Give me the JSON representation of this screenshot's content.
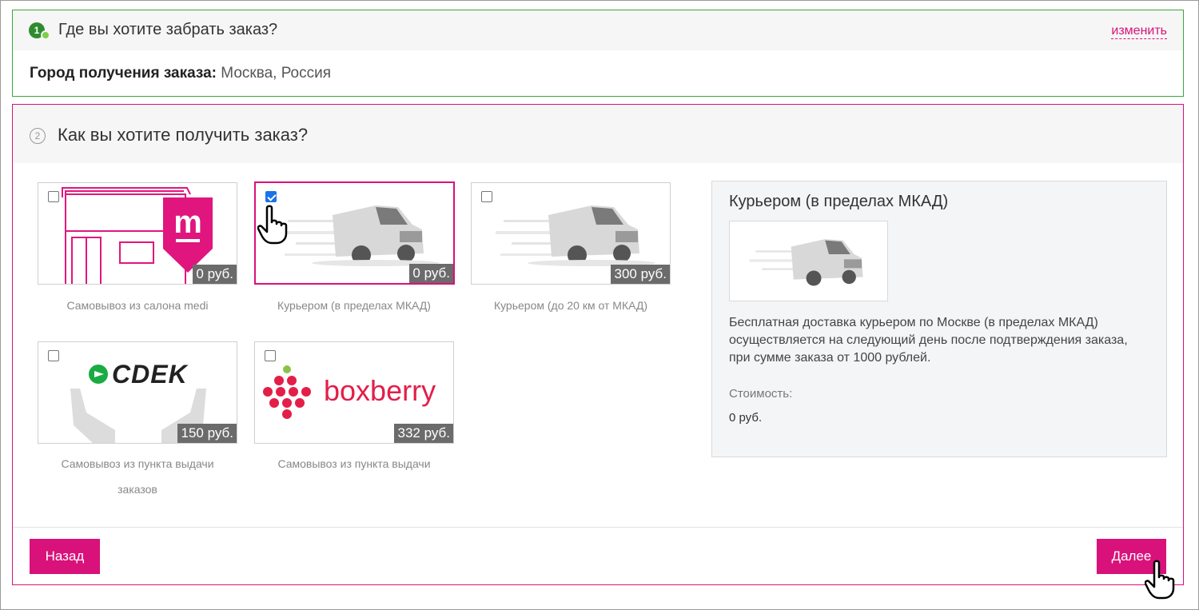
{
  "step1": {
    "number": "1",
    "title": "Где вы хотите забрать заказ?",
    "change_link": "изменить",
    "city_label": "Город получения заказа:",
    "city_value": "Москва, Россия"
  },
  "step2": {
    "number": "2",
    "title": "Как вы хотите получить заказ?",
    "options": [
      {
        "label": "Самовывоз из салона medi",
        "price": "0 руб.",
        "checked": false,
        "icon": "medi-store-icon"
      },
      {
        "label": "Курьером (в пределах МКАД)",
        "price": "0 руб.",
        "checked": true,
        "icon": "courier-van-icon"
      },
      {
        "label": "Курьером (до 20 км от МКАД)",
        "price": "300 руб.",
        "checked": false,
        "icon": "courier-van-icon"
      },
      {
        "label_line1": "Самовывоз из пункта выдачи",
        "label_line2": "заказов",
        "price": "150 руб.",
        "checked": false,
        "icon": "cdek-logo",
        "logo_text": "CDEK"
      },
      {
        "label": "Самовывоз из пункта выдачи",
        "price": "332 руб.",
        "checked": false,
        "icon": "boxberry-logo",
        "logo_text": "boxberry"
      }
    ],
    "detail": {
      "title": "Курьером (в пределах МКАД)",
      "description": "Бесплатная доставка курьером по Москве (в пределах МКАД) осуществляется на следующий день после подтверждения заказа, при сумме заказа от 1000 рублей.",
      "cost_label": "Стоимость:",
      "cost_value": "0 руб."
    },
    "back_button": "Назад",
    "next_button": "Далее"
  },
  "colors": {
    "accent": "#d8127a",
    "step_done": "#3aa83a",
    "price_tag": "#6b6b6b"
  }
}
